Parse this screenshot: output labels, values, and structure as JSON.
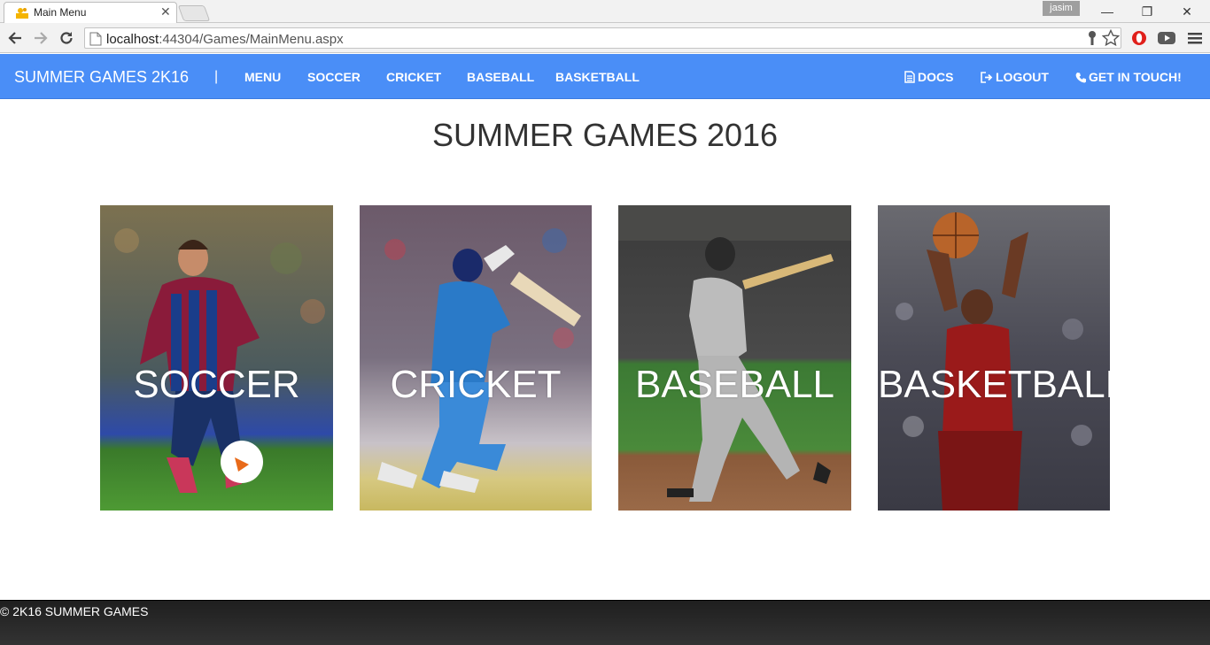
{
  "browser": {
    "tab_title": "Main Menu",
    "tab_close": "✕",
    "user_badge": "jasim",
    "url_host": "localhost",
    "url_rest": ":44304/Games/MainMenu.aspx",
    "window_controls": {
      "minimize": "—",
      "restore": "❐",
      "close": "✕"
    }
  },
  "navbar": {
    "brand": "SUMMER GAMES 2K16",
    "separator": "|",
    "links": [
      "MENU",
      "SOCCER",
      "CRICKET",
      "BASEBALL",
      "BASKETBALL"
    ],
    "right_links": [
      {
        "label": "DOCS",
        "icon": "document-icon"
      },
      {
        "label": "LOGOUT",
        "icon": "logout-icon"
      },
      {
        "label": "GET IN TOUCH!",
        "icon": "phone-icon"
      }
    ],
    "color": "#4a8ef7"
  },
  "main": {
    "title": "SUMMER GAMES 2016",
    "cards": [
      {
        "label": "SOCCER"
      },
      {
        "label": "CRICKET"
      },
      {
        "label": "BASEBALL"
      },
      {
        "label": "BASKETBALL"
      }
    ]
  },
  "footer": {
    "text": "© 2K16 SUMMER GAMES"
  }
}
